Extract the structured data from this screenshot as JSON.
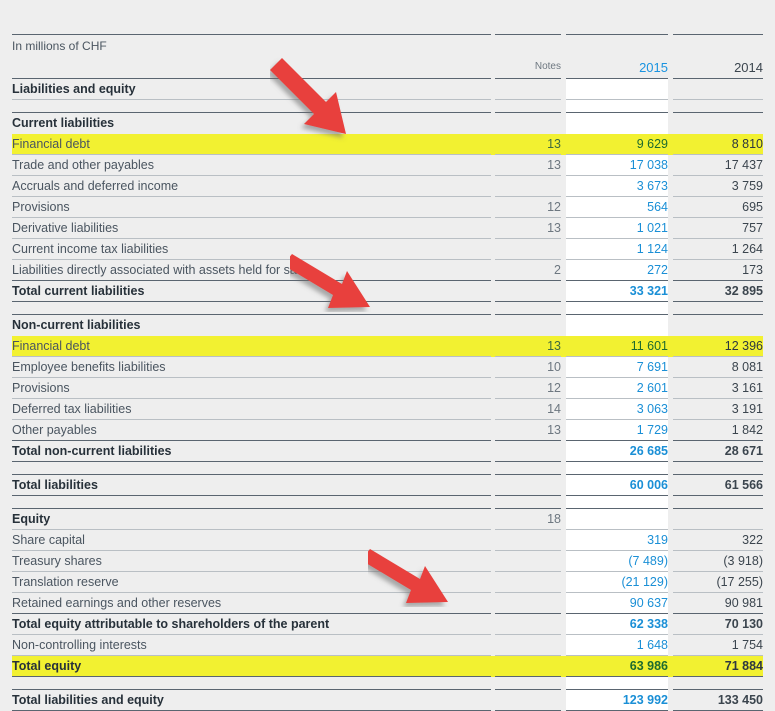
{
  "document": {
    "unit_caption": "In millions of CHF",
    "columns": {
      "notes": "Notes",
      "year_current": "2015",
      "year_prior": "2014"
    },
    "accent_blue": "#1a93e0",
    "highlight_yellow": "#f2f131",
    "arrow_red": "#e8413c"
  },
  "rows": [
    {
      "label": "Liabilities and equity",
      "notes": "",
      "y2015": "",
      "y2014": ""
    },
    {
      "label": "Current liabilities",
      "notes": "",
      "y2015": "",
      "y2014": ""
    },
    {
      "label": "Financial debt",
      "notes": "13",
      "y2015": "9 629",
      "y2014": "8 810"
    },
    {
      "label": "Trade and other payables",
      "notes": "13",
      "y2015": "17 038",
      "y2014": "17 437"
    },
    {
      "label": "Accruals and deferred income",
      "notes": "",
      "y2015": "3 673",
      "y2014": "3 759"
    },
    {
      "label": "Provisions",
      "notes": "12",
      "y2015": "564",
      "y2014": "695"
    },
    {
      "label": "Derivative liabilities",
      "notes": "13",
      "y2015": "1 021",
      "y2014": "757"
    },
    {
      "label": "Current income tax liabilities",
      "notes": "",
      "y2015": "1 124",
      "y2014": "1 264"
    },
    {
      "label": "Liabilities directly associated with assets held for sale",
      "notes": "2",
      "y2015": "272",
      "y2014": "173"
    },
    {
      "label": "Total current liabilities",
      "notes": "",
      "y2015": "33 321",
      "y2014": "32 895"
    },
    {
      "label": "Non-current liabilities",
      "notes": "",
      "y2015": "",
      "y2014": ""
    },
    {
      "label": "Financial debt",
      "notes": "13",
      "y2015": "11 601",
      "y2014": "12 396"
    },
    {
      "label": "Employee benefits liabilities",
      "notes": "10",
      "y2015": "7 691",
      "y2014": "8 081"
    },
    {
      "label": "Provisions",
      "notes": "12",
      "y2015": "2 601",
      "y2014": "3 161"
    },
    {
      "label": "Deferred tax liabilities",
      "notes": "14",
      "y2015": "3 063",
      "y2014": "3 191"
    },
    {
      "label": "Other payables",
      "notes": "13",
      "y2015": "1 729",
      "y2014": "1 842"
    },
    {
      "label": "Total non-current liabilities",
      "notes": "",
      "y2015": "26 685",
      "y2014": "28 671"
    },
    {
      "label": "Total liabilities",
      "notes": "",
      "y2015": "60 006",
      "y2014": "61 566"
    },
    {
      "label": "Equity",
      "notes": "18",
      "y2015": "",
      "y2014": ""
    },
    {
      "label": "Share capital",
      "notes": "",
      "y2015": "319",
      "y2014": "322"
    },
    {
      "label": "Treasury shares",
      "notes": "",
      "y2015": "(7 489)",
      "y2014": "(3 918)"
    },
    {
      "label": "Translation reserve",
      "notes": "",
      "y2015": "(21 129)",
      "y2014": "(17 255)"
    },
    {
      "label": "Retained earnings and other reserves",
      "notes": "",
      "y2015": "90 637",
      "y2014": "90 981"
    },
    {
      "label": "Total equity attributable to shareholders of the parent",
      "notes": "",
      "y2015": "62 338",
      "y2014": "70 130"
    },
    {
      "label": "Non-controlling interests",
      "notes": "",
      "y2015": "1 648",
      "y2014": "1 754"
    },
    {
      "label": "Total equity",
      "notes": "",
      "y2015": "63 986",
      "y2014": "71 884"
    },
    {
      "label": "Total liabilities and equity",
      "notes": "",
      "y2015": "123 992",
      "y2014": "133 450"
    }
  ],
  "annotations": {
    "arrows": [
      {
        "name": "arrow-current-financial-debt",
        "target_row": "Financial debt"
      },
      {
        "name": "arrow-noncurrent-financial-debt",
        "target_row": "Financial debt"
      },
      {
        "name": "arrow-total-equity",
        "target_row": "Total equity"
      }
    ]
  }
}
